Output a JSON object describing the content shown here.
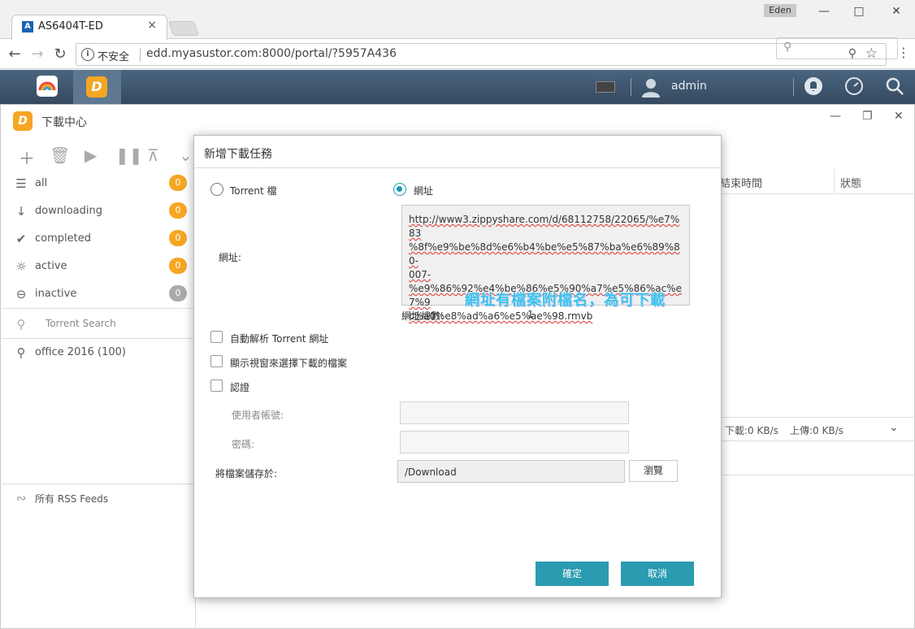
{
  "browser": {
    "tab_title": "AS6404T-ED",
    "tab_close": "×",
    "profile_name": "Eden",
    "insecure_label": "不安全",
    "url": "edd.myasustor.com:8000/portal/?5957A436"
  },
  "adm": {
    "user_name": "admin"
  },
  "app": {
    "title": "下載中心",
    "sidebar": {
      "items": [
        {
          "label": "all",
          "count": "0",
          "icon": "list-icon"
        },
        {
          "label": "downloading",
          "count": "0",
          "icon": "arrow-down-icon"
        },
        {
          "label": "completed",
          "count": "0",
          "icon": "checkmark-icon"
        },
        {
          "label": "active",
          "count": "0",
          "icon": "sun-icon"
        },
        {
          "label": "inactive",
          "count": "0",
          "icon": "minus-circle-icon"
        }
      ],
      "torrent_search_placeholder": "Torrent Search",
      "saved_search": "office 2016 (100)",
      "rss_label": "所有 RSS Feeds"
    },
    "columns": {
      "end_time": "結束時間",
      "status": "狀態"
    },
    "status_bar": {
      "download": "下載:0 KB/s",
      "upload": "上傳:0 KB/s"
    }
  },
  "dialog": {
    "title": "新增下載任務",
    "radio_torrent": "Torrent 檔",
    "radio_url": "網址",
    "url_label": "網址:",
    "url_value_lines": [
      "http://www3.zippyshare.com/d/68112758/22065/%e7%83",
      "%8f%e9%be%8d%e6%b4%be%e5%87%ba%e6%89%80-",
      "007-",
      "%e9%86%92%e4%be%86%e5%90%a7%e5%86%ac%e7%9",
      "c%a0%e8%ad%a6%e5%ae%98.rmvb"
    ],
    "overlay_note": "網址有檔案附檔名，為可下載",
    "url_count_label": "網址總數:",
    "url_count_value": "1",
    "auto_parse_label": "自動解析 Torrent 網址",
    "show_window_label": "顯示視窗來選擇下載的檔案",
    "auth_label": "認證",
    "username_label": "使用者帳號:",
    "password_label": "密碼:",
    "save_to_label": "將檔案儲存於:",
    "save_path": "/Download",
    "browse_button": "瀏覽",
    "ok_button": "確定",
    "cancel_button": "取消"
  },
  "colors": {
    "accent": "#2a9bb0",
    "badge": "#f5a623",
    "adm_bar": "#3e5870",
    "overlay_text": "#3fc1ec"
  }
}
